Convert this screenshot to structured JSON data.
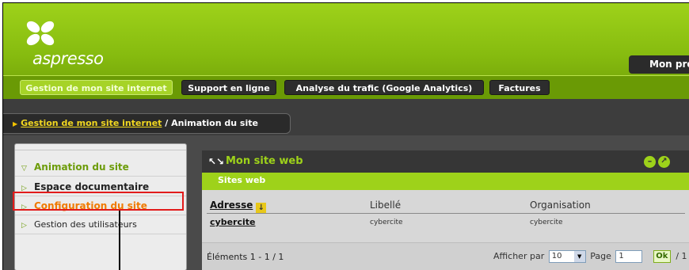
{
  "colors": {
    "brand_green": "#9ed21a",
    "dark_bg": "#3f3f3f",
    "active_item": "#f07a00",
    "highlight_box": "#e21b1b",
    "link_yellow": "#f2d820"
  },
  "logo": {
    "text": "aspresso",
    "icon": "flower-logo-icon"
  },
  "header": {
    "profile_tab": "Mon profil"
  },
  "nav": {
    "tabs": [
      {
        "label": "Gestion de mon site internet",
        "active": true
      },
      {
        "label": "Support en ligne",
        "active": false
      },
      {
        "label": "Analyse du trafic (Google Analytics)",
        "active": false
      },
      {
        "label": "Factures",
        "active": false
      }
    ]
  },
  "breadcrumb": {
    "link": "Gestion de mon site internet",
    "separator": " / ",
    "current": "Animation du site",
    "icon": "arrow-right-icon"
  },
  "sidebar": {
    "items": [
      {
        "label": "Animation du site",
        "icon": "triangle-down-icon"
      },
      {
        "label": "Espace documentaire",
        "icon": "triangle-right-icon"
      },
      {
        "label": "Configuration du site",
        "icon": "triangle-right-icon"
      },
      {
        "label": "Gestion des utilisateurs",
        "icon": "triangle-right-icon"
      }
    ]
  },
  "panel": {
    "title": "Mon site web",
    "subtab": "Sites web",
    "table": {
      "headers": [
        "Adresse",
        "Libellé",
        "Organisation"
      ],
      "rows": [
        [
          "cybercite",
          "cybercite",
          "cybercite"
        ]
      ]
    },
    "footer": {
      "elements": "Éléments 1 - 1 / 1",
      "afficher_par": "Afficher par",
      "per_page": "10",
      "page_label": "Page",
      "page_value": "1",
      "ok": "Ok",
      "total": "/ 1"
    }
  }
}
